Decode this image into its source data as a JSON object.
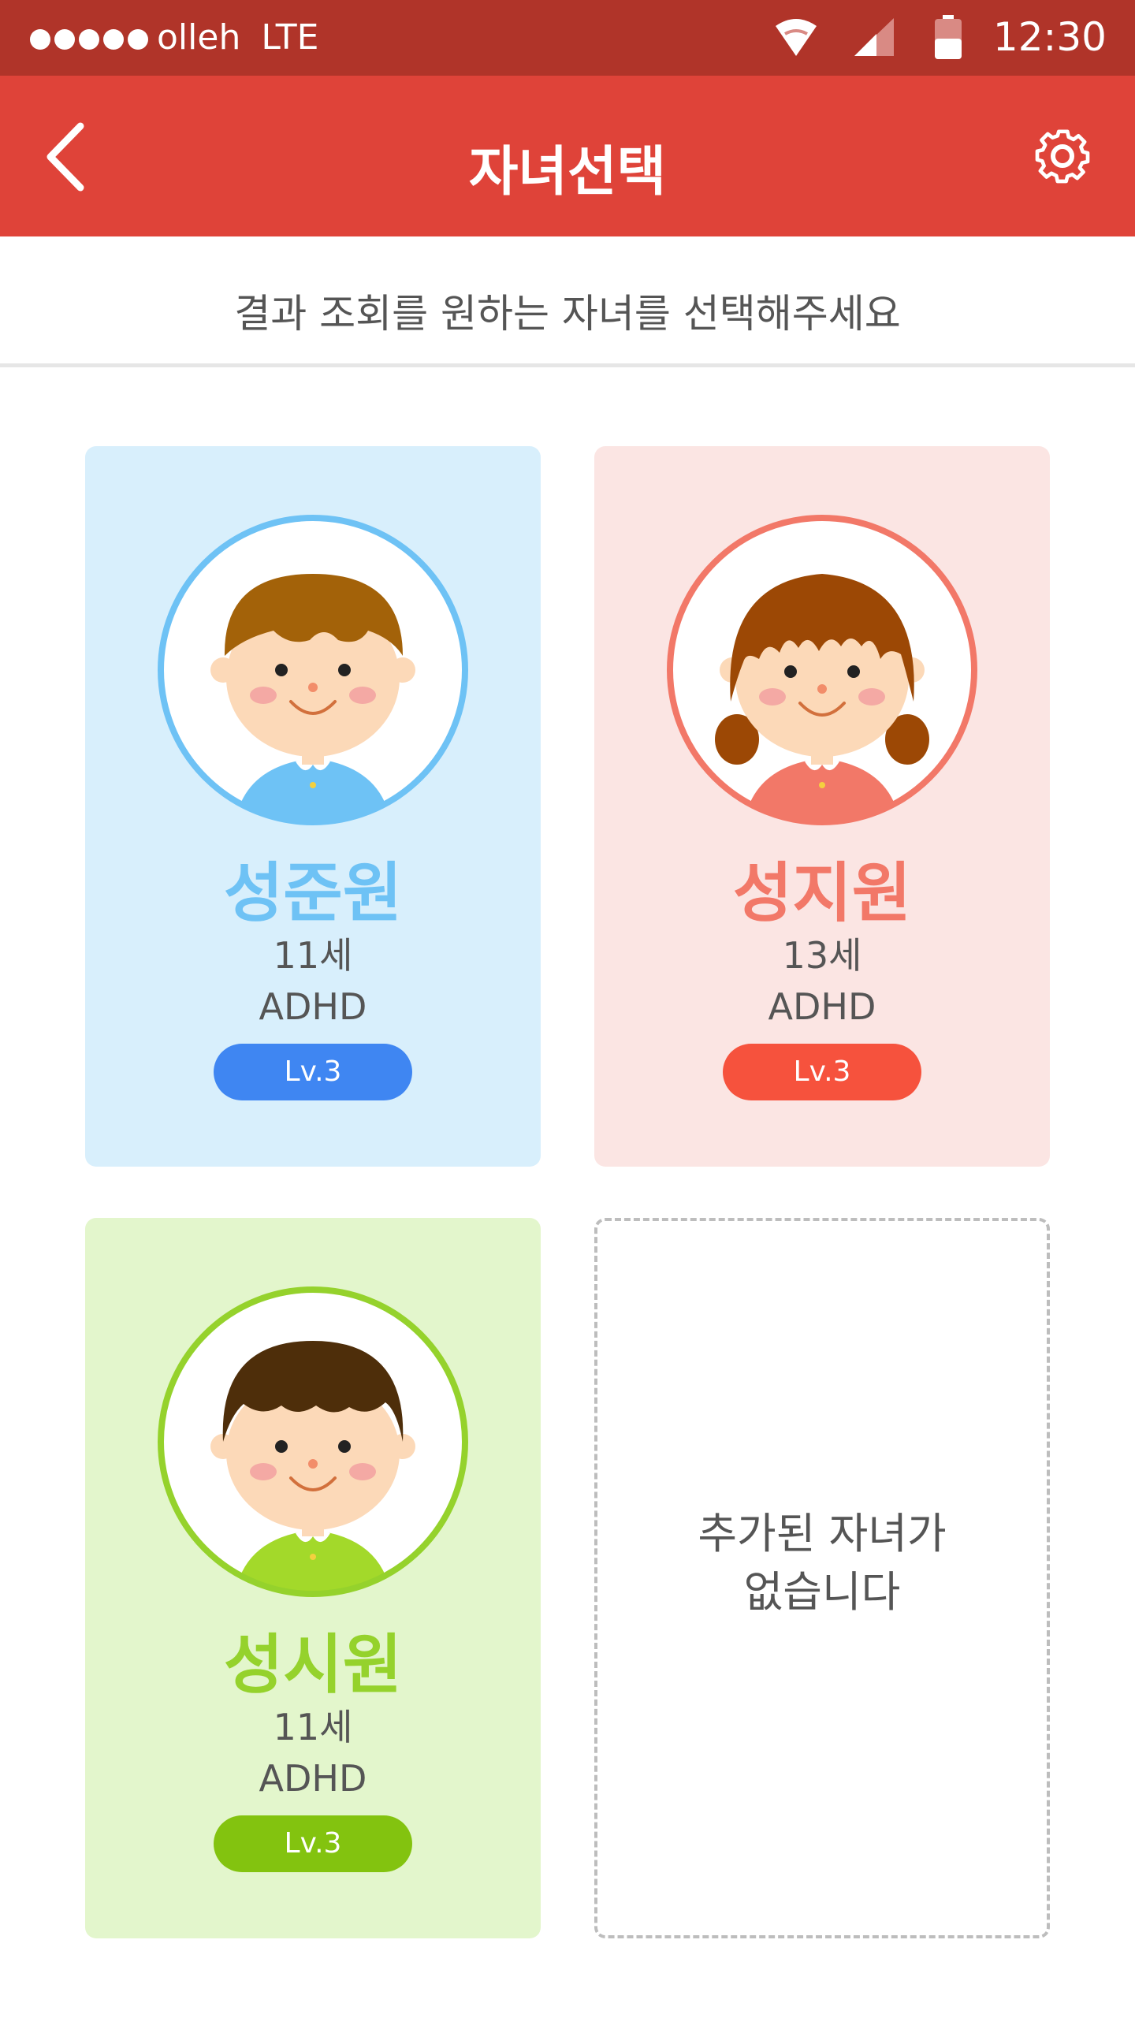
{
  "status_bar": {
    "carrier": "olleh",
    "network": "LTE",
    "time": "12:30",
    "icons": [
      "signal-dots-icon",
      "wifi-icon",
      "cell-signal-icon",
      "battery-icon"
    ]
  },
  "app_bar": {
    "title": "자녀선택",
    "back_icon": "chevron-left-icon",
    "settings_icon": "gear-icon",
    "background": "#df4339"
  },
  "subheader": {
    "text": "결과 조회를 원하는 자녀를 선택해주세요"
  },
  "children": [
    {
      "name": "성준원",
      "age": "11세",
      "diagnosis": "ADHD",
      "level": "Lv.3",
      "avatar": "boy-avatar",
      "name_color": "#6ec2f5",
      "badge_color": "#3f86f2",
      "card_color": "#d8effc"
    },
    {
      "name": "성지원",
      "age": "13세",
      "diagnosis": "ADHD",
      "level": "Lv.3",
      "avatar": "girl-avatar",
      "name_color": "#f27868",
      "badge_color": "#f6523d",
      "card_color": "#fbe5e3"
    },
    {
      "name": "성시원",
      "age": "11세",
      "diagnosis": "ADHD",
      "level": "Lv.3",
      "avatar": "boy-avatar",
      "name_color": "#95d22c",
      "badge_color": "#83c30f",
      "card_color": "#e3f6cc"
    }
  ],
  "empty_slot": {
    "line1": "추가된 자녀가",
    "line2": "없습니다"
  }
}
